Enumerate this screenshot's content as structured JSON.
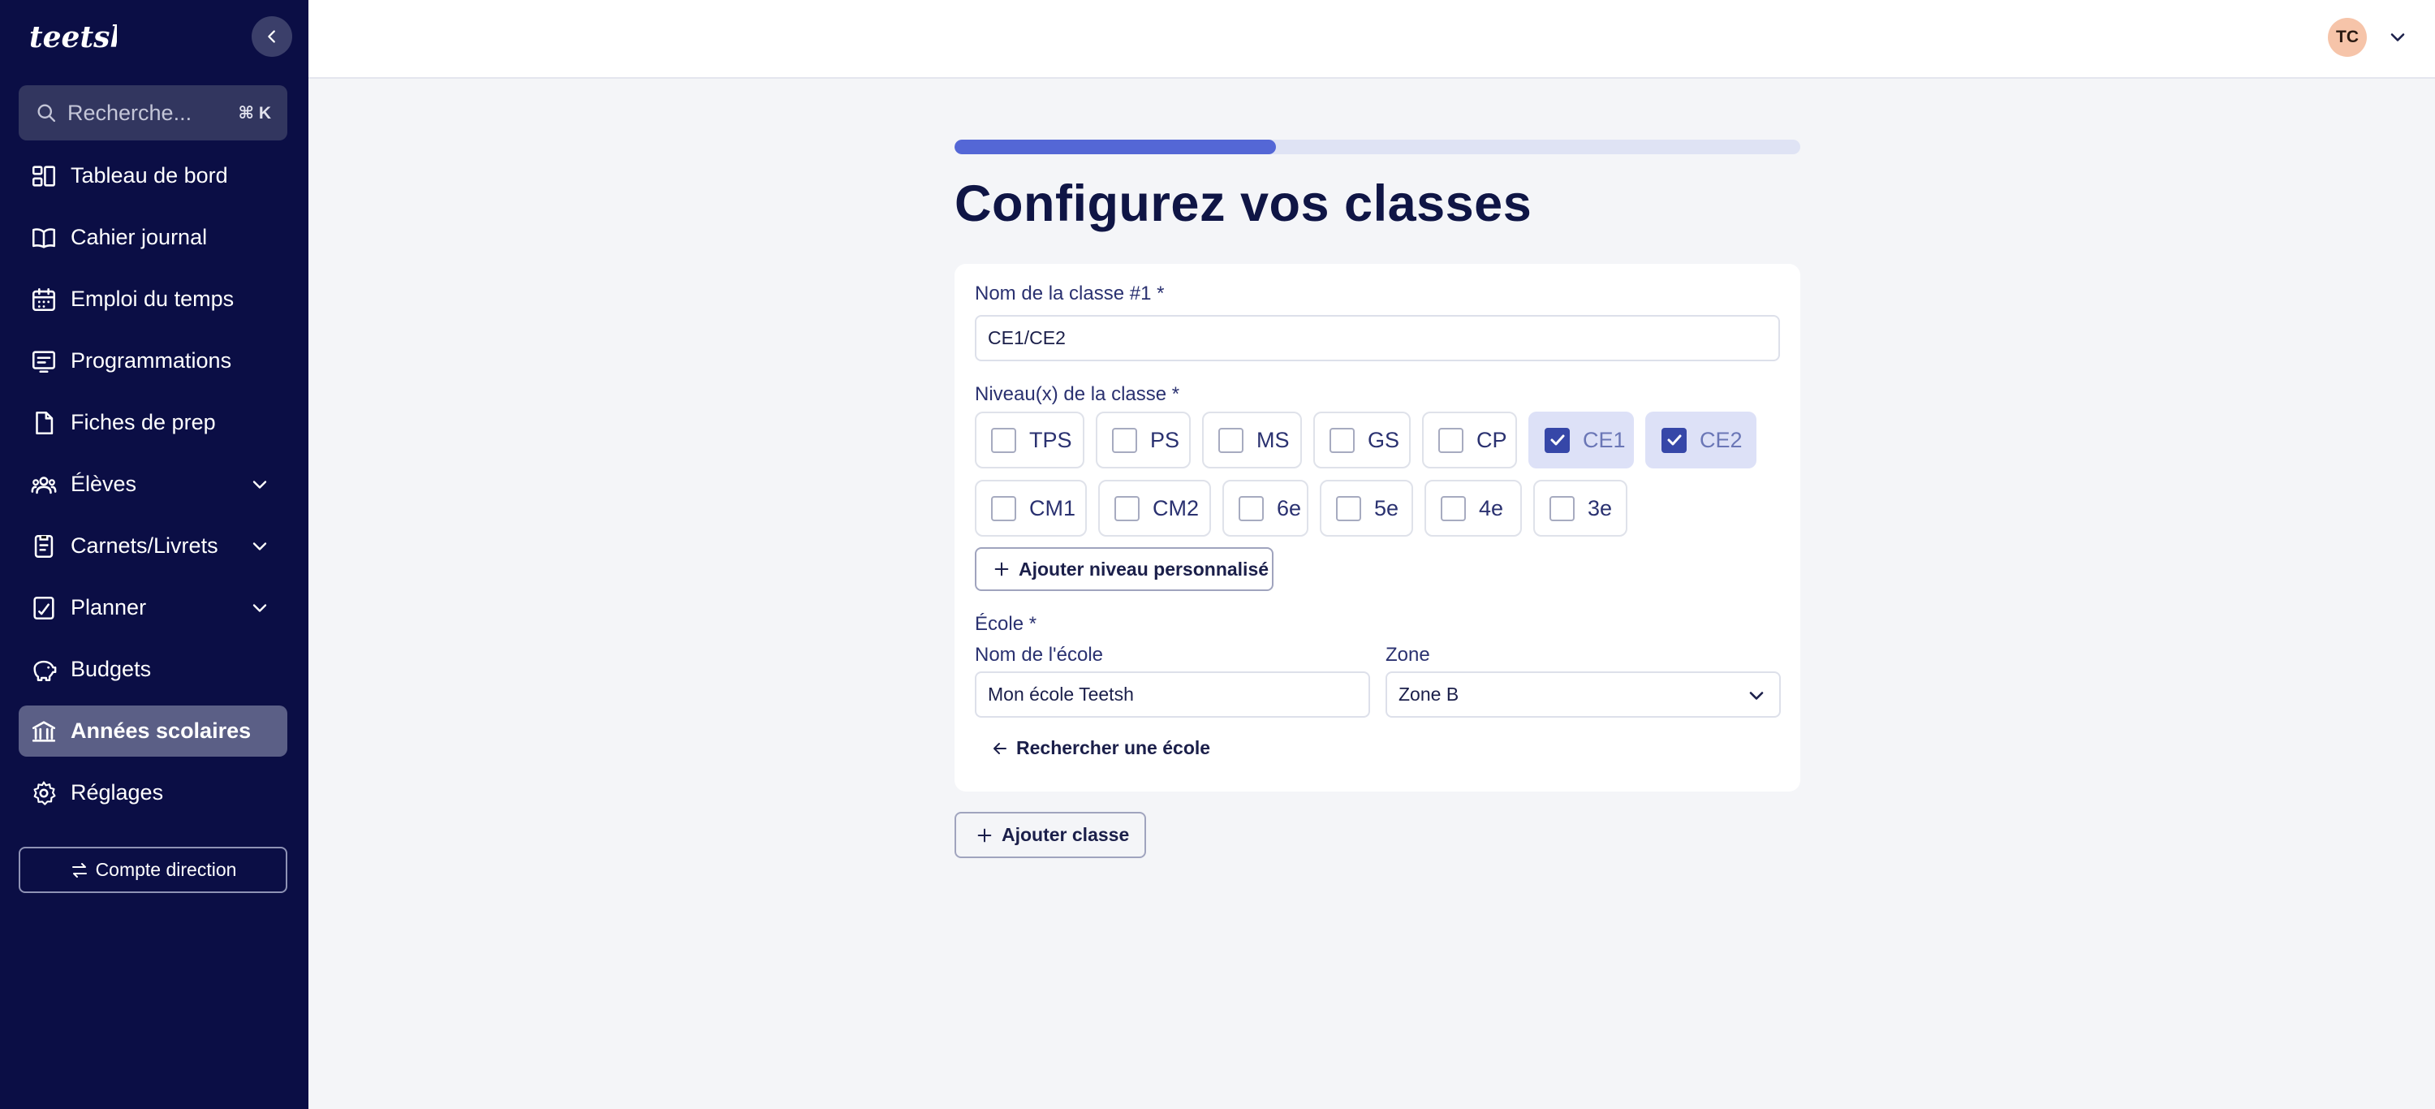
{
  "sidebar": {
    "logo_text": "teetsh",
    "search": {
      "placeholder": "Recherche...",
      "shortcut": "⌘ K"
    },
    "items": [
      {
        "label": "Tableau de bord",
        "icon": "dashboard-icon"
      },
      {
        "label": "Cahier journal",
        "icon": "book-icon"
      },
      {
        "label": "Emploi du temps",
        "icon": "calendar-icon"
      },
      {
        "label": "Programmations",
        "icon": "presentation-icon"
      },
      {
        "label": "Fiches de prep",
        "icon": "document-icon"
      },
      {
        "label": "Élèves",
        "icon": "users-icon",
        "expandable": true
      },
      {
        "label": "Carnets/Livrets",
        "icon": "notebook-icon",
        "expandable": true
      },
      {
        "label": "Planner",
        "icon": "planner-icon",
        "expandable": true
      },
      {
        "label": "Budgets",
        "icon": "piggy-bank-icon"
      },
      {
        "label": "Années scolaires",
        "icon": "school-icon",
        "active": true
      },
      {
        "label": "Réglages",
        "icon": "gear-icon"
      }
    ],
    "account_button": "Compte direction"
  },
  "header": {
    "avatar_initials": "TC"
  },
  "main": {
    "progress_fraction": 0.38,
    "title": "Configurez vos classes",
    "class_form": {
      "name_label": "Nom de la classe #1 *",
      "name_value": "CE1/CE2",
      "levels_label": "Niveau(x) de la classe *",
      "levels_row1": [
        {
          "label": "TPS",
          "checked": false
        },
        {
          "label": "PS",
          "checked": false
        },
        {
          "label": "MS",
          "checked": false
        },
        {
          "label": "GS",
          "checked": false
        },
        {
          "label": "CP",
          "checked": false
        },
        {
          "label": "CE1",
          "checked": true
        },
        {
          "label": "CE2",
          "checked": true
        }
      ],
      "levels_row2": [
        {
          "label": "CM1",
          "checked": false
        },
        {
          "label": "CM2",
          "checked": false
        },
        {
          "label": "6e",
          "checked": false
        },
        {
          "label": "5e",
          "checked": false
        },
        {
          "label": "4e",
          "checked": false
        },
        {
          "label": "3e",
          "checked": false
        }
      ],
      "add_level_button": "Ajouter niveau personnalisé",
      "school_label": "École *",
      "school_name_label": "Nom de l'école",
      "school_name_value": "Mon école Teetsh",
      "zone_label": "Zone",
      "zone_value": "Zone B",
      "search_school_link": "Rechercher une école"
    },
    "add_class_button": "Ajouter classe"
  },
  "colors": {
    "sidebar_bg": "#0b0e45",
    "accent": "#5467d6",
    "checked_bg": "#dde1f7",
    "checkbox_checked": "#3647a8",
    "avatar_bg": "#f6c4a9"
  }
}
